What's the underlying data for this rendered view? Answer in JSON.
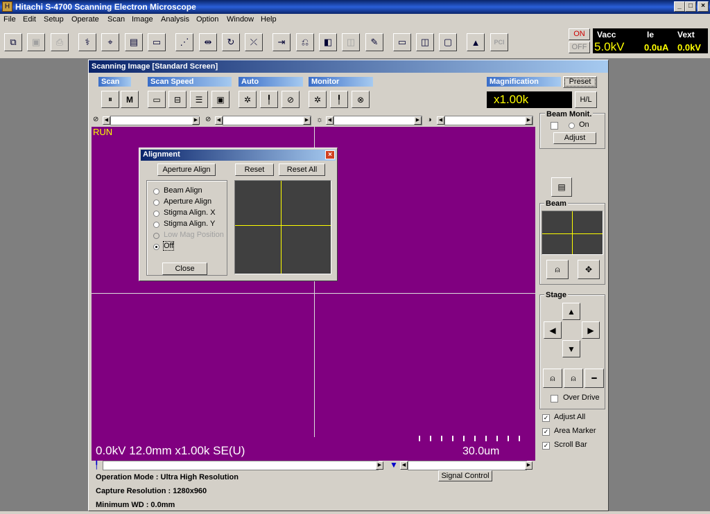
{
  "app": {
    "title": "Hitachi S-4700 Scanning Electron Microscope",
    "icon": "app-icon"
  },
  "window_controls": {
    "minimize": "_",
    "maximize": "□",
    "close": "×"
  },
  "menu": [
    "File",
    "Edit",
    "Setup",
    "Operate",
    "Scan",
    "Image",
    "Analysis",
    "Option",
    "Window",
    "Help"
  ],
  "toolbar": {
    "icons": [
      "window-icon",
      "save-icon",
      "print-icon",
      "beam-align-icon",
      "crosshair-icon",
      "image-store-icon",
      "image-number-icon",
      "stigma-icon",
      "split-icon",
      "rotate-icon",
      "tilt-icon",
      "signal-route-icon",
      "detector-icon",
      "color-icon",
      "dual-icon",
      "edit-icon",
      "screen-1-icon",
      "screen-2-icon",
      "screen-3-icon",
      "histogram-icon",
      "pci-icon"
    ],
    "pci_label": "PCI"
  },
  "hv": {
    "on": "ON",
    "off": "OFF",
    "vacc_label": "Vacc",
    "vacc_value": "5.0kV",
    "ie_label": "Ie",
    "ie_value": "0.0uA",
    "vext_label": "Vext",
    "vext_value": "0.0kV"
  },
  "scan_window": {
    "title": "Scanning Image [Standard Screen]",
    "groups": {
      "scan": "Scan",
      "scan_speed": "Scan Speed",
      "auto": "Auto",
      "monitor": "Monitor",
      "magnification": "Magnification"
    },
    "scan_icons": [
      "pause-icon",
      "memory-icon"
    ],
    "scan_speed_icons": [
      "speed-1-icon",
      "speed-2-icon",
      "speed-3-icon",
      "speed-4-icon"
    ],
    "auto_icons": [
      "auto-brightness-icon",
      "auto-focus-icon",
      "auto-stigma-icon"
    ],
    "monitor_icons": [
      "monitor-brightness-icon",
      "monitor-focus-icon",
      "monitor-stigma-icon"
    ],
    "preset": "Preset",
    "mag_value": "x1.00k",
    "hl": "H/L",
    "run": "RUN",
    "image_info": "0.0kV 12.0mm x1.00k SE(U)",
    "scale_bar": "30.0um",
    "signal_control": "Signal Control",
    "operation_mode": "Operation Mode : Ultra High Resolution",
    "capture_resolution": "Capture Resolution : 1280x960",
    "min_wd": "Minimum WD : 0.0mm",
    "beam_monit": {
      "title": "Beam Monit.",
      "on": "On",
      "adjust": "Adjust"
    },
    "beam": {
      "title": "Beam"
    },
    "stage": {
      "title": "Stage",
      "over_drive": "Over Drive"
    },
    "options": {
      "adjust_all": "Adjust All",
      "area_marker": "Area Marker",
      "scroll_bar": "Scroll Bar"
    }
  },
  "alignment": {
    "title": "Alignment",
    "mode_button": "Aperture Align",
    "reset": "Reset",
    "reset_all": "Reset All",
    "options": [
      "Beam  Align",
      "Aperture Align",
      "Stigma Align. X",
      "Stigma Align. Y",
      "Low Mag Position",
      "Off"
    ],
    "selected": "Off",
    "close": "Close"
  },
  "colors": {
    "image_bg": "#800080",
    "overlay_text": "#ffff00",
    "title_blue": "#0a246a"
  }
}
